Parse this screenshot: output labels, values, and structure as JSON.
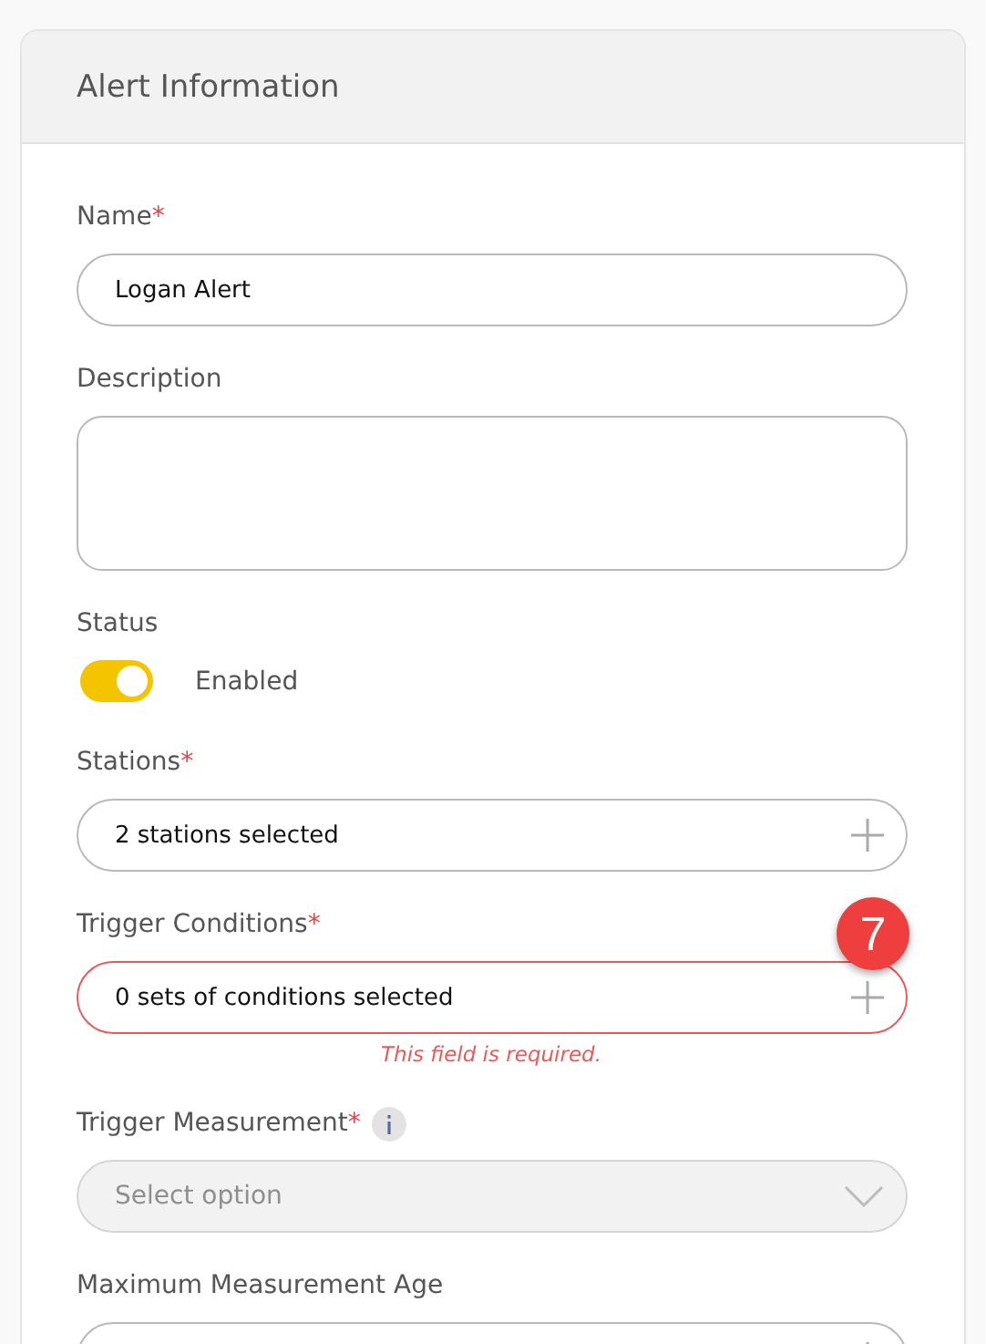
{
  "card": {
    "title": "Alert Information"
  },
  "fields": [
    {
      "kind": "text",
      "label": "Name",
      "required_mark": "*",
      "value": "Logan Alert"
    },
    {
      "kind": "textarea",
      "label": "Description"
    },
    {
      "kind": "toggle",
      "label": "Status",
      "on": true,
      "state_text": "Enabled"
    },
    {
      "kind": "picker",
      "label": "Stations",
      "required_mark": "*",
      "value": "2 stations selected",
      "invalid": false
    },
    {
      "kind": "picker",
      "label": "Trigger Conditions",
      "required_mark": "*",
      "value": "0 sets of conditions selected",
      "invalid": true,
      "error": "This field is required.",
      "badge": "7"
    },
    {
      "kind": "select",
      "label": "Trigger Measurement",
      "required_mark": "*",
      "info": true,
      "disabled": true,
      "placeholder": "Select option"
    },
    {
      "kind": "picker",
      "label": "Maximum Measurement Age",
      "invalid": false
    }
  ]
}
